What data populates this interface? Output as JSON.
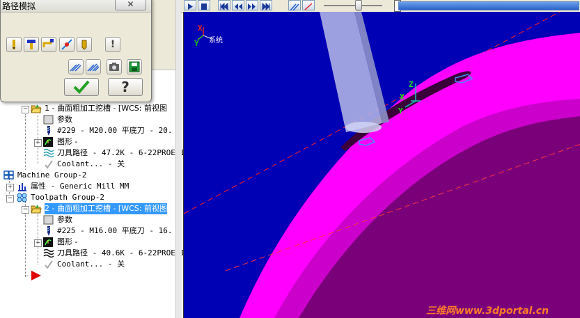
{
  "dialog": {
    "title": "路径模拟",
    "help_glyph": "?",
    "stop_glyph": "!"
  },
  "tree": {
    "op1": {
      "label": "1 - 曲面粗加工挖槽 - [WCS: 前视图",
      "params": "参数",
      "tool": "#229 - M20.00 平底刀 -    20.",
      "geometry": "图形 -",
      "toolpath": "刀具路径 - 47.2K - 6-22PROE-1",
      "coolant": "Coolant... - 关"
    },
    "machine_group": "Machine Group-2",
    "properties": "属性 - Generic Mill MM",
    "toolpath_group": "Toolpath Group-2",
    "op2": {
      "label": "2 - 曲面粗加工挖槽 - [WCS: 前视图",
      "params": "参数",
      "tool": "#225 - M16.00 平底刀 -    16.",
      "geometry": "图形 -",
      "toolpath": "刀具路径 - 40.6K - 6-22PROE-1",
      "coolant": "Coolant... - 关"
    }
  },
  "viewport": {
    "gview_x": "X",
    "gview_y": "Y",
    "gview_label": "系统",
    "tool_axis_z": "Z",
    "tool_axis_x": "X",
    "tool_axis_y": "Y",
    "background_color": "#0000b4",
    "part_color": "#ff00ff",
    "part_inner_color": "#7a007a"
  },
  "playback": {
    "progress": 1.0
  },
  "watermark": "三维网www.3dportal.cn"
}
